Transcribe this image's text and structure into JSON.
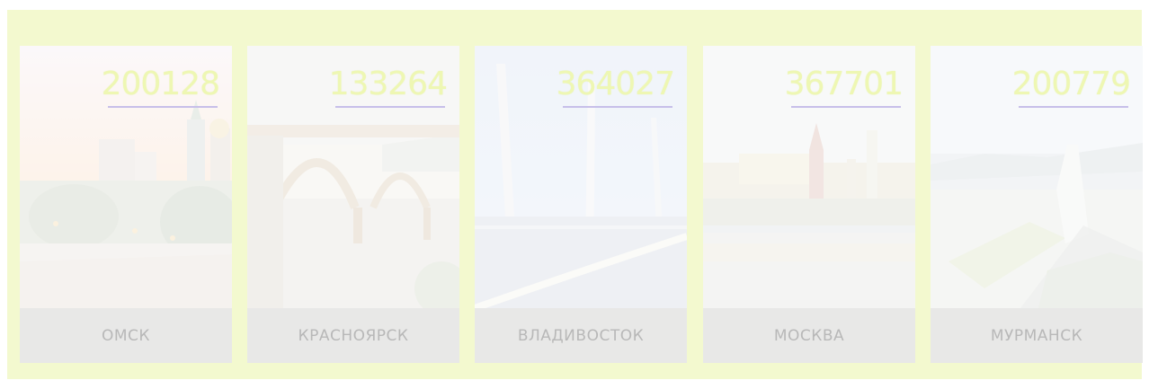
{
  "cities": [
    {
      "value": "200128",
      "name": "ОМСК"
    },
    {
      "value": "133264",
      "name": "КРАСНОЯРСК"
    },
    {
      "value": "364027",
      "name": "ВЛАДИВОСТОК"
    },
    {
      "value": "367701",
      "name": "МОСКВА"
    },
    {
      "value": "200779",
      "name": "МУРМАНСК"
    }
  ],
  "colors": {
    "panel_background": "#f3f9cf",
    "number_color": "#eef7b3",
    "underline_color": "#c7bfe9",
    "label_band": "#e8e8e7",
    "label_text": "#b8b8b8"
  }
}
